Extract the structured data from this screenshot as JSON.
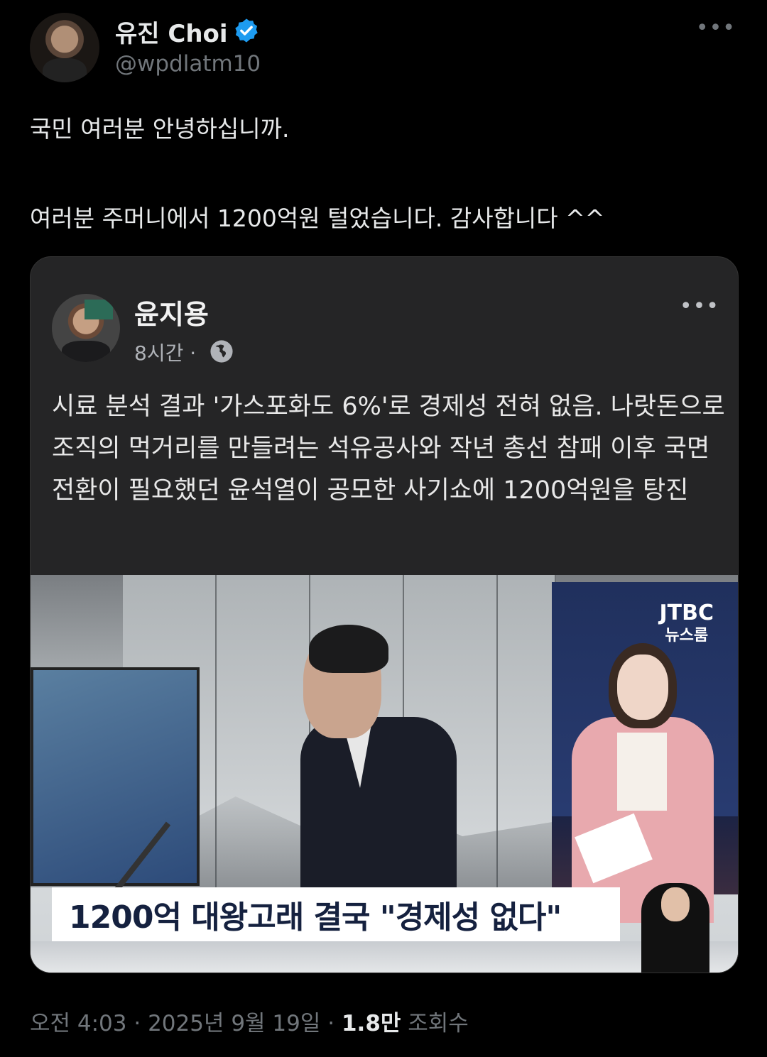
{
  "tweet": {
    "display_name": "유진 Choi",
    "handle": "@wpdlatm10",
    "text_line1": "국민 여러분 안녕하십니까.",
    "text_line2": "여러분 주머니에서 1200억원 털었습니다. 감사합니다 ^^",
    "more_icon": "more-horizontal-icon",
    "verified_icon": "verified-badge-icon"
  },
  "embedded_post": {
    "author": "윤지용",
    "time": "8시간 ·",
    "privacy_icon": "globe-icon",
    "body": "시료 분석 결과 '가스포화도 6%'로 경제성 전혀 없음. 나랏돈으로 조직의 먹거리를 만들려는 석유공사와 작년 총선 참패 이후 국면전환이 필요했던 윤석열이 공모한 사기쇼에 1200억원을 탕진",
    "image": {
      "logo_line1": "JTBC",
      "logo_line2": "뉴스룸",
      "headline": "1200억 대왕고래 결국 \"경제성 없다\""
    }
  },
  "footer": {
    "time": "오전 4:03 · 2025년 9월 19일 · ",
    "views_count": "1.8만",
    "views_label": " 조회수"
  },
  "colors": {
    "background": "#000000",
    "verified": "#1d9bf0",
    "card": "#252526",
    "secondary_text": "#71767b"
  }
}
